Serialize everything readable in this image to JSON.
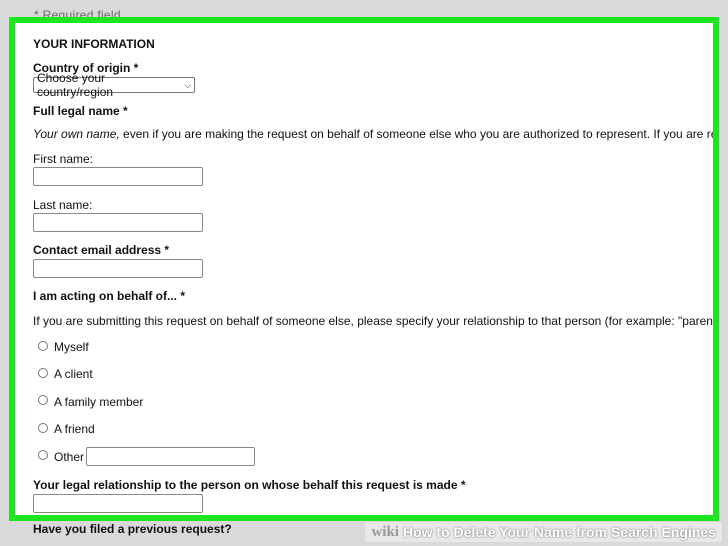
{
  "page": {
    "top_hint": "* Required field",
    "after_frame_question": "Have you filed a previous request?"
  },
  "form": {
    "section_title": "YOUR INFORMATION",
    "country": {
      "label": "Country of origin *",
      "selected": "Choose your country/region"
    },
    "full_legal_name": {
      "label": "Full legal name *",
      "help_italic": "Your own name,",
      "help_rest": " even if you are making the request on behalf of someone else who you are authorized to represent. If you are representin"
    },
    "first_name": {
      "label": "First name:",
      "value": ""
    },
    "last_name": {
      "label": "Last name:",
      "value": ""
    },
    "email": {
      "label": "Contact email address *",
      "value": ""
    },
    "acting_on_behalf": {
      "label": "I am acting on behalf of... *",
      "help": "If you are submitting this request on behalf of someone else, please specify your relationship to that person (for example: \"parent\", \"attorney\"",
      "options": [
        "Myself",
        "A client",
        "A family member",
        "A friend",
        "Other"
      ],
      "other_value": ""
    },
    "legal_relationship": {
      "label": "Your legal relationship to the person on whose behalf this request is made *",
      "value": ""
    }
  },
  "watermark": {
    "wiki": "wiki",
    "how_to": "How to Delete Your Name from Search Engines"
  },
  "colors": {
    "frame_border": "#1ee61e",
    "background": "#d9d9d9"
  }
}
